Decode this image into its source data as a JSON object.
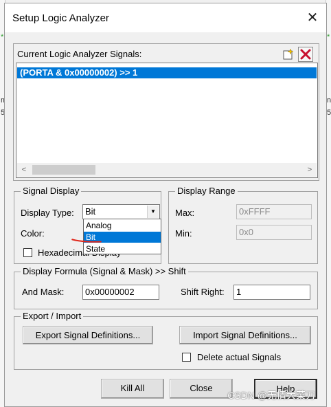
{
  "window": {
    "title": "Setup Logic Analyzer",
    "close_glyph": "✕"
  },
  "background": {
    "left_marks": [
      "*",
      "m",
      "5"
    ],
    "right_marks": [
      "*",
      "n",
      "5"
    ]
  },
  "signals": {
    "label": "Current Logic Analyzer Signals:",
    "items": [
      "(PORTA & 0x00000002) >> 1"
    ],
    "selected_index": 0
  },
  "toolbar_icons": [
    "new-signal-icon",
    "delete-signal-icon"
  ],
  "scroll": {
    "left_arrow": "<",
    "right_arrow": ">"
  },
  "signal_display": {
    "group_title": "Signal Display",
    "display_type_label": "Display Type:",
    "display_type_value": "Bit",
    "color_label": "Color:",
    "hex_label": "Hexadecimal Display",
    "hex_checked": false,
    "dropdown_arrow": "▼",
    "dropdown_options": [
      "Analog",
      "Bit",
      "State"
    ],
    "dropdown_selected": "Bit"
  },
  "display_range": {
    "group_title": "Display Range",
    "max_label": "Max:",
    "max_value": "0xFFFF",
    "min_label": "Min:",
    "min_value": "0x0"
  },
  "formula": {
    "group_title": "Display Formula (Signal & Mask) >> Shift",
    "and_mask_label": "And Mask:",
    "and_mask_value": "0x00000002",
    "shift_right_label": "Shift Right:",
    "shift_right_value": "1"
  },
  "export_import": {
    "group_title": "Export / Import",
    "export_button": "Export Signal Definitions...",
    "import_button": "Import Signal Definitions...",
    "delete_label": "Delete actual Signals",
    "delete_checked": false
  },
  "buttons": {
    "kill_all": "Kill All",
    "close": "Close",
    "help": "Help"
  },
  "watermark": "CSDN @无情大菜刀",
  "colors": {
    "selection": "#0078d7",
    "annotation": "#e0261a",
    "delete_icon": "#c8102e"
  }
}
